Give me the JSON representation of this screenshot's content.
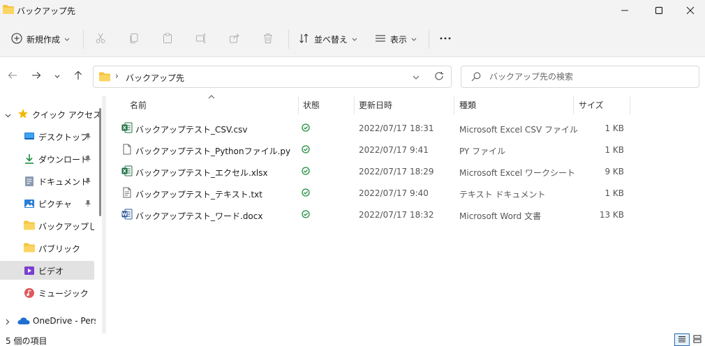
{
  "window": {
    "title": "バックアップ先",
    "icon": "folder-icon"
  },
  "toolbar": {
    "new_label": "新規作成",
    "sort_label": "並べ替え",
    "view_label": "表示"
  },
  "address": {
    "crumb": "バックアップ先"
  },
  "search": {
    "placeholder": "バックアップ先の検索"
  },
  "sidebar": {
    "quick_access_label": "クイック アクセス",
    "items": [
      {
        "label": "デスクトップ",
        "icon": "desktop-icon",
        "pinned": true
      },
      {
        "label": "ダウンロード",
        "icon": "download-icon",
        "pinned": true
      },
      {
        "label": "ドキュメント",
        "icon": "document-icon",
        "pinned": true
      },
      {
        "label": "ピクチャ",
        "icon": "pictures-icon",
        "pinned": true
      },
      {
        "label": "バックアップしたい",
        "icon": "folder-icon",
        "pinned": false
      },
      {
        "label": "パブリック",
        "icon": "folder-icon",
        "pinned": false
      },
      {
        "label": "ビデオ",
        "icon": "video-icon",
        "pinned": false,
        "selected": true
      },
      {
        "label": "ミュージック",
        "icon": "music-icon",
        "pinned": false
      }
    ],
    "onedrive_label": "OneDrive - Perso"
  },
  "columns": {
    "name": "名前",
    "status": "状態",
    "modified": "更新日時",
    "type": "種類",
    "size": "サイズ"
  },
  "files": [
    {
      "name": "バックアップテスト_CSV.csv",
      "icon": "excel-csv-icon",
      "status": "synced",
      "modified": "2022/07/17 18:31",
      "type": "Microsoft Excel CSV ファイル",
      "size": "1 KB"
    },
    {
      "name": "バックアップテスト_Pythonファイル.py",
      "icon": "generic-file-icon",
      "status": "synced",
      "modified": "2022/07/17 9:41",
      "type": "PY ファイル",
      "size": "1 KB"
    },
    {
      "name": "バックアップテスト_エクセル.xlsx",
      "icon": "excel-icon",
      "status": "synced",
      "modified": "2022/07/17 18:29",
      "type": "Microsoft Excel ワークシート",
      "size": "9 KB"
    },
    {
      "name": "バックアップテスト_テキスト.txt",
      "icon": "text-file-icon",
      "status": "synced",
      "modified": "2022/07/17 9:40",
      "type": "テキスト ドキュメント",
      "size": "1 KB"
    },
    {
      "name": "バックアップテスト_ワード.docx",
      "icon": "word-icon",
      "status": "synced",
      "modified": "2022/07/17 18:32",
      "type": "Microsoft Word 文書",
      "size": "13 KB"
    }
  ],
  "statusbar": {
    "count": "5 個の項目"
  },
  "colors": {
    "folder": "#f4c542",
    "synced": "#1e8e3e",
    "selection": "#e2e2e2",
    "accent": "#2b6cb0"
  }
}
